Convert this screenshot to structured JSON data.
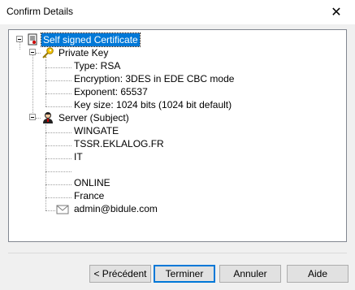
{
  "window": {
    "title": "Confirm Details",
    "close_glyph": "✕"
  },
  "tree": {
    "root": {
      "label": "Self signed Certificate",
      "icon": "certificate-icon"
    },
    "private_key": {
      "label": "Private Key",
      "icon": "key-icon",
      "children": [
        "Type: RSA",
        "Encryption: 3DES in EDE CBC mode",
        "Exponent: 65537",
        "Key size: 1024 bits (1024 bit default)"
      ]
    },
    "server": {
      "label": "Server (Subject)",
      "icon": "person-icon",
      "children": [
        "WINGATE",
        "TSSR.EKLALOG.FR",
        "IT",
        "",
        "ONLINE",
        "France"
      ],
      "email": {
        "label": "admin@bidule.com",
        "icon": "envelope-icon"
      }
    }
  },
  "buttons": {
    "back": "< Précédent",
    "finish": "Terminer",
    "cancel": "Annuler",
    "help": "Aide"
  },
  "colors": {
    "selection": "#0078d7",
    "default_button_border": "#0078d7"
  }
}
